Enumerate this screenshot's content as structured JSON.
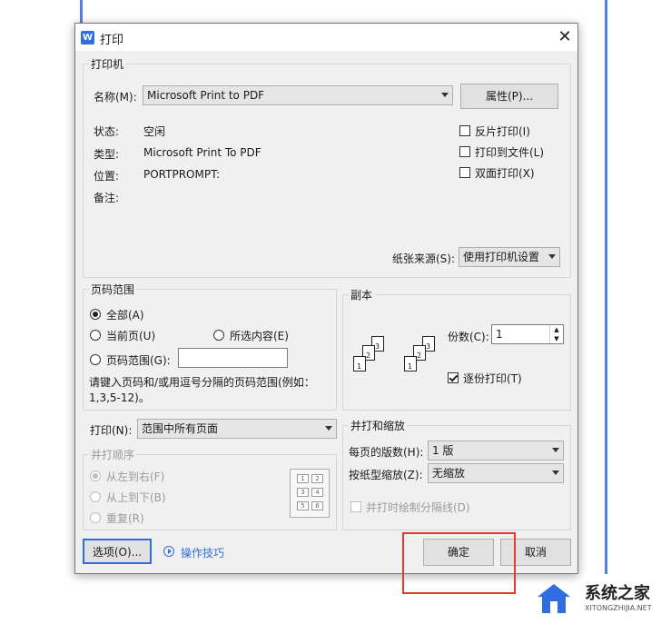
{
  "dialog": {
    "title": "打印",
    "logo": "W",
    "close_glyph": "✕"
  },
  "printer": {
    "group": "打印机",
    "name_label": "名称(M):",
    "name_value": "Microsoft Print to PDF",
    "props_button": "属性(P)...",
    "status_label": "状态:",
    "status_value": "空闲",
    "type_label": "类型:",
    "type_value": "Microsoft Print To PDF",
    "location_label": "位置:",
    "location_value": "PORTPROMPT:",
    "comment_label": "备注:",
    "reverse_print": "反片打印(I)",
    "print_to_file": "打印到文件(L)",
    "duplex": "双面打印(X)",
    "paper_source_label": "纸张来源(S):",
    "paper_source_value": "使用打印机设置"
  },
  "range": {
    "group": "页码范围",
    "all": "全部(A)",
    "current": "当前页(U)",
    "selection": "所选内容(E)",
    "pages": "页码范围(G):",
    "pages_value": "",
    "hint": "请键入页码和/或用逗号分隔的页码范围(例如：1,3,5-12)。"
  },
  "copies": {
    "group": "副本",
    "count_label": "份数(C):",
    "count_value": "1",
    "collate": "逐份打印(T)"
  },
  "print_what": {
    "label": "打印(N):",
    "value": "范围中所有页面"
  },
  "order": {
    "group": "并打顺序",
    "ltr": "从左到右(F)",
    "ttb": "从上到下(B)",
    "repeat": "重复(R)"
  },
  "zoom": {
    "group": "并打和缩放",
    "pages_per_sheet_label": "每页的版数(H):",
    "pages_per_sheet_value": "1 版",
    "scale_label": "按纸型缩放(Z):",
    "scale_value": "无缩放",
    "draw_lines": "并打时绘制分隔线(D)"
  },
  "footer": {
    "options": "选项(O)...",
    "tips": "操作技巧",
    "ok": "确定",
    "cancel": "取消"
  },
  "watermark": {
    "brand": "系统之家",
    "url": "XITONGZHIJIA.NET"
  },
  "colors": {
    "accent": "#2f6de0",
    "highlight": "#e53a2e",
    "dialog_bg": "#f0f0f0"
  }
}
